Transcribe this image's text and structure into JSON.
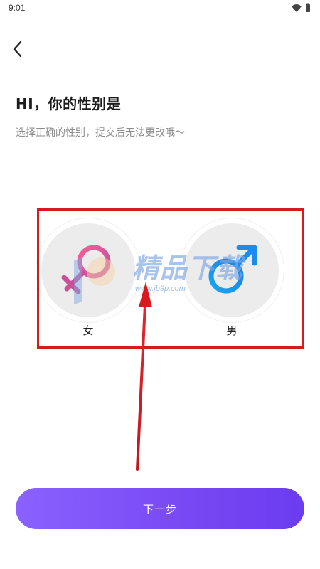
{
  "status_bar": {
    "time": "9:01",
    "icons": [
      "wifi-icon",
      "battery-icon"
    ]
  },
  "nav": {
    "back_icon": "chevron-left-icon"
  },
  "header": {
    "title": "HI，你的性别是",
    "subtitle": "选择正确的性别，提交后无法更改哦～"
  },
  "gender_options": [
    {
      "label": "女",
      "icon": "female-symbol-icon",
      "color": "#e85f94"
    },
    {
      "label": "男",
      "icon": "male-symbol-icon",
      "color": "#1e9df2"
    }
  ],
  "watermark": {
    "text": "精品下载",
    "url": "www.jb9p.com"
  },
  "annotation": {
    "highlight_color": "#d71920"
  },
  "footer": {
    "next_label": "下一步",
    "button_color": "#7a4af4"
  }
}
